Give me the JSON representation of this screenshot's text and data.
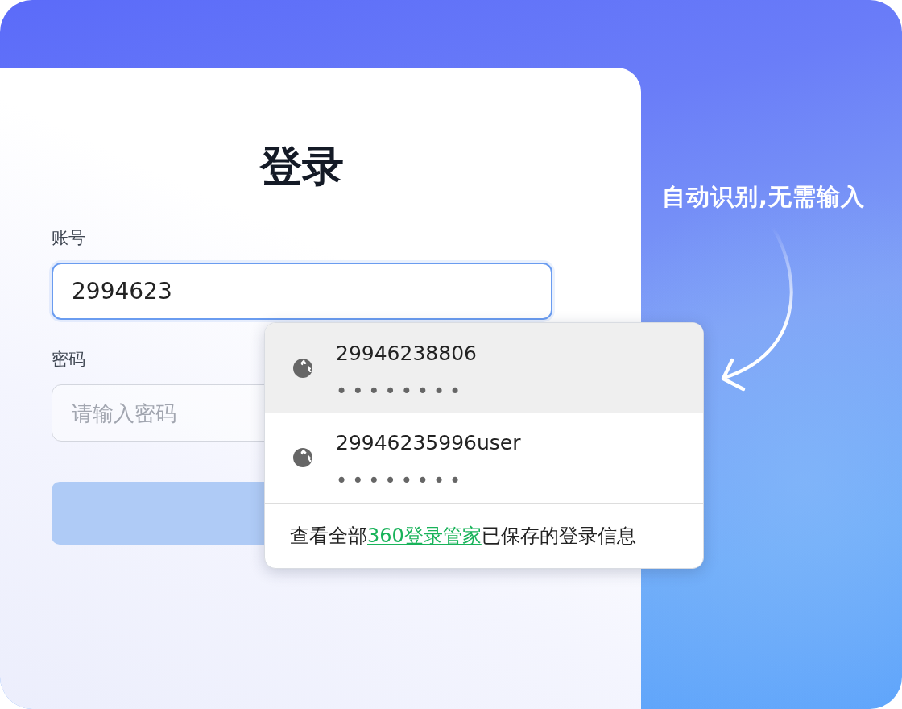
{
  "login_form": {
    "title": "登录",
    "fields": [
      {
        "label": "账号",
        "value": "2994623",
        "focused": true
      },
      {
        "label": "密码",
        "placeholder": "请输入密码",
        "focused": false
      }
    ]
  },
  "callout": {
    "text": "自动识别,无需输入"
  },
  "autocomplete": {
    "suggestions": [
      {
        "username": "29946238806",
        "password_mask": "••••••••",
        "selected": true
      },
      {
        "username": "29946235996user",
        "password_mask": "••••••••",
        "selected": false
      }
    ],
    "footer": {
      "before": "查看全部",
      "link": "360登录管家",
      "after": "已保存的登录信息"
    }
  }
}
